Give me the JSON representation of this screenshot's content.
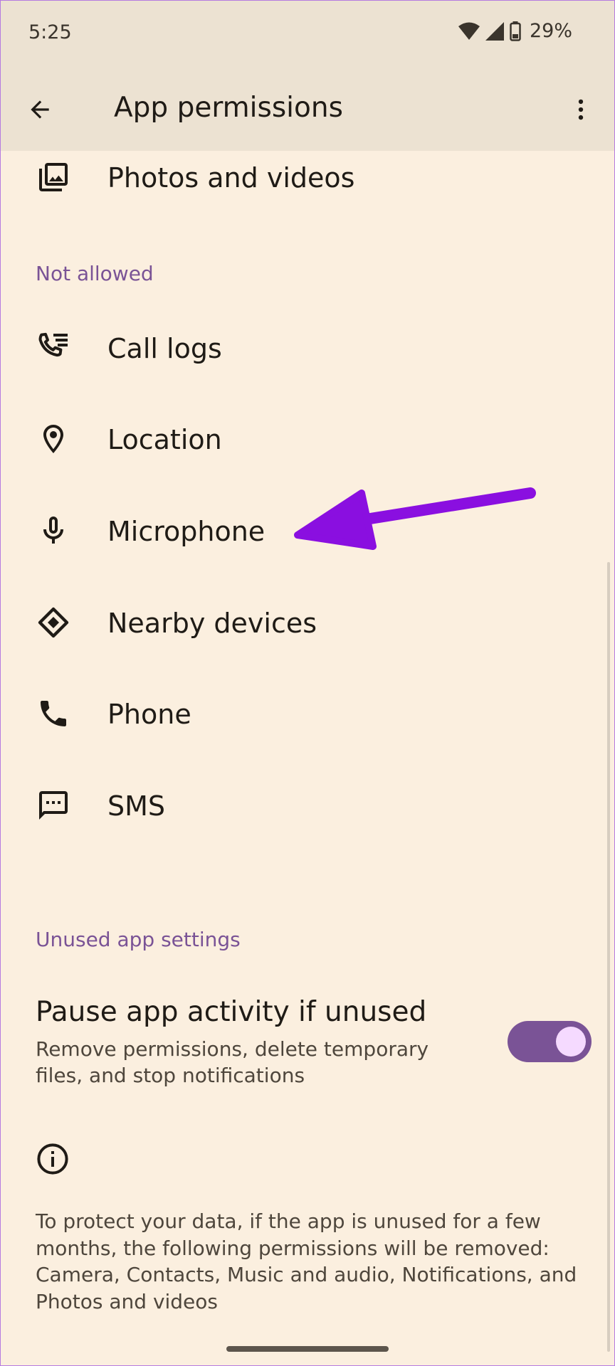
{
  "status_bar": {
    "time": "5:25",
    "battery_percent": "29%",
    "icons": [
      "wifi-icon",
      "signal-icon",
      "battery-icon"
    ]
  },
  "app_bar": {
    "title": "App permissions",
    "back_icon": "back-arrow-icon",
    "menu_icon": "more-vert-icon"
  },
  "allowed_items": [
    {
      "label": "Photos and videos",
      "icon": "photos-icon"
    }
  ],
  "not_allowed": {
    "header": "Not allowed",
    "items": [
      {
        "label": "Call logs",
        "icon": "call-log-icon"
      },
      {
        "label": "Location",
        "icon": "location-icon"
      },
      {
        "label": "Microphone",
        "icon": "microphone-icon"
      },
      {
        "label": "Nearby devices",
        "icon": "nearby-devices-icon"
      },
      {
        "label": "Phone",
        "icon": "phone-icon"
      },
      {
        "label": "SMS",
        "icon": "sms-icon"
      }
    ]
  },
  "unused_settings": {
    "header": "Unused app settings",
    "pause_title": "Pause app activity if unused",
    "pause_description": "Remove permissions, delete temporary files, and stop notifications",
    "pause_enabled": true,
    "info_icon": "info-icon",
    "info_text": "To protect your data, if the app is unused for a few months, the following permissions will be removed: Camera, Contacts, Music and audio, Notifications, and Photos and videos"
  },
  "colors": {
    "background": "#FBEFDF",
    "app_bar": "#ECE2D2",
    "accent": "#7A5396",
    "annotation_arrow": "#8A0FE0"
  }
}
